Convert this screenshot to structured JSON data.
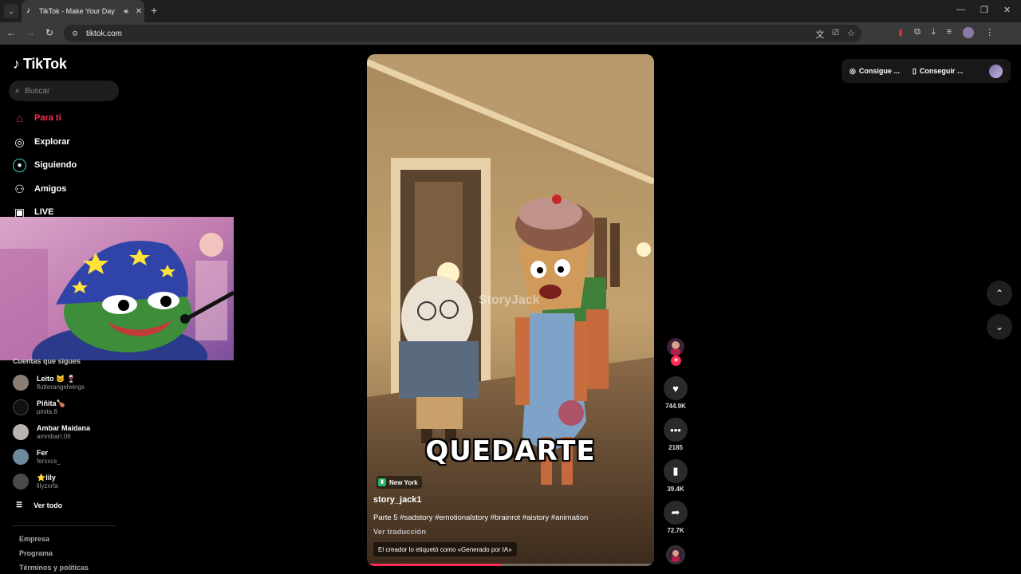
{
  "browser": {
    "tab_title": "TikTok - Make Your Day",
    "url": "tiktok.com"
  },
  "sidebar": {
    "logo_text": "TikTok",
    "search_placeholder": "Buscar",
    "nav": [
      {
        "label": "Para ti",
        "icon": "home-icon",
        "active": true
      },
      {
        "label": "Explorar",
        "icon": "compass-icon"
      },
      {
        "label": "Siguiendo",
        "icon": "following-icon"
      },
      {
        "label": "Amigos",
        "icon": "friends-icon"
      },
      {
        "label": "LIVE",
        "icon": "live-icon"
      }
    ],
    "following_title": "Cuentas que sigues",
    "accounts": [
      {
        "name": "Leito 🐱 🍷",
        "handle": "flutterangelwings"
      },
      {
        "name": "Piñita🍗",
        "handle": "pinita.8"
      },
      {
        "name": "Ambar Maidana",
        "handle": "ammbarr.06"
      },
      {
        "name": "Fer",
        "handle": "fersxcs_"
      },
      {
        "name": "⭐lily",
        "handle": "lilyzxrfa"
      }
    ],
    "see_all": "Ver todo",
    "footer": [
      "Empresa",
      "Programa",
      "Términos y políticas"
    ]
  },
  "video": {
    "caption_overlay": "QUEDARTE",
    "watermark": "StoryJack",
    "location": "New York",
    "author": "story_jack1",
    "description": "Parte 5 #sadstory #emotionalstory #brainrot #aistory #animation",
    "translate": "Ver traducción",
    "ai_label": "El creador lo etiquetó como «Generado por IA»",
    "progress": 0.47
  },
  "actions": {
    "likes": "744.9K",
    "comments": "2185",
    "saves": "39.4K",
    "shares": "72.7K"
  },
  "top_right": {
    "get_coins": "Consigue ...",
    "get_app": "Conseguir ..."
  }
}
